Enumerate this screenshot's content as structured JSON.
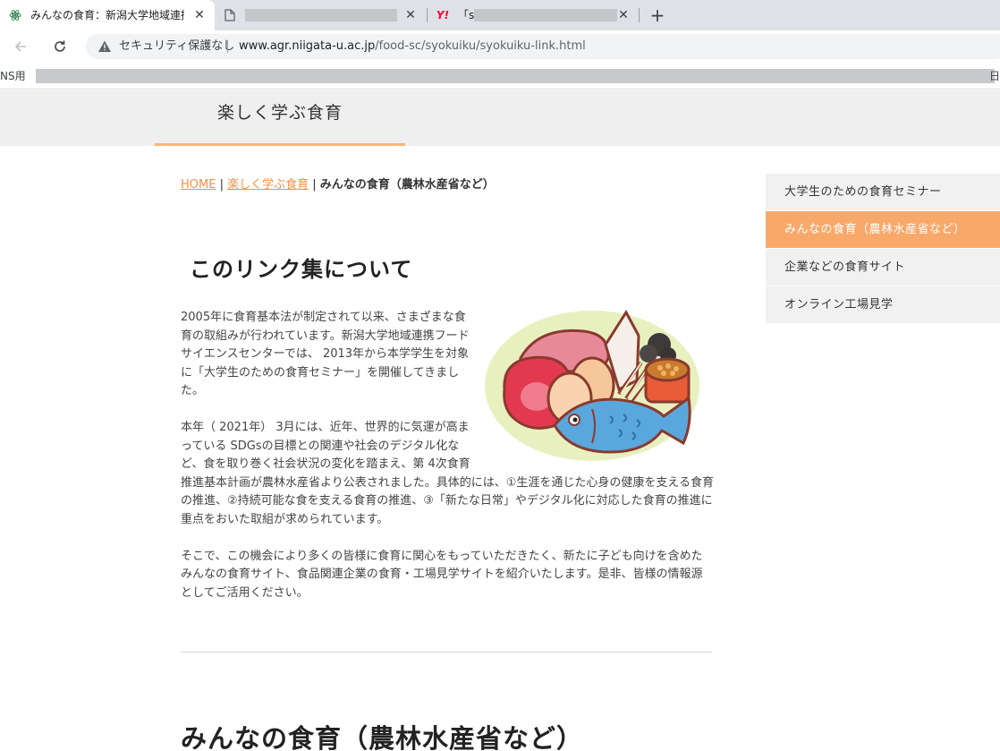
{
  "browser": {
    "tabs": [
      {
        "title": "みんなの食育：新潟大学地域連携",
        "active": true
      },
      {
        "title": "",
        "redacted": true
      },
      {
        "title": "「sv",
        "redacted": true
      }
    ],
    "omnibox": {
      "security_label": "セキュリティ保護なし",
      "url_host": "www.agr.niigata-u.ac.jp",
      "url_path": "/food-sc/syokuiku/syokuiku-link.html"
    },
    "bookmarks": {
      "left_fragment": "NS用",
      "right_fragment": "日"
    }
  },
  "site": {
    "title": "楽しく学ぶ食育"
  },
  "breadcrumb": {
    "home": "HOME",
    "separator": " | ",
    "parent": "楽しく学ぶ食育",
    "current": "みんなの食育（農林水産省など）"
  },
  "intro": {
    "heading": "このリンク集について",
    "paragraphs": [
      "2005年に食育基本法が制定されて以来、さまざまな食育の取組みが行われています。新潟大学地域連携フードサイエンスセンターでは、 2013年から本学学生を対象に「大学生のための食育セミナー」を開催してきました。",
      "本年（ 2021年） 3月には、近年、世界的に気運が高まっている SDGsの目標との関連や社会のデジタル化など、食を取り巻く社会状況の変化を踏まえ、第 4次食育推進基本計画が農林水産省より公表されました。具体的には、①生涯を通じた心身の健康を支える食育の推進、②持続可能な食を支える食育の推進、③「新たな日常」やデジタル化に対応した食育の推進に重点をおいた取組が求められています。",
      "そこで、この機会により多くの皆様に食育に関心をもっていただきたく、新たに子ども向けを含めたみんなの食育サイト、食品関連企業の食育・工場見学サイトを紹介いたします。是非、皆様の情報源としてご活用ください。"
    ]
  },
  "next_section": {
    "heading": "みんなの食育（農林水産省など）"
  },
  "sidenav": {
    "items": [
      {
        "label": "大学生のための食育セミナー",
        "active": false
      },
      {
        "label": "みんなの食育（農林水産省など）",
        "active": true
      },
      {
        "label": "企業などの食育サイト",
        "active": false
      },
      {
        "label": "オンライン工場見学",
        "active": false
      }
    ]
  },
  "colors": {
    "accent": "#f8a96a",
    "link": "#f19149",
    "header_bg": "#efefef"
  }
}
